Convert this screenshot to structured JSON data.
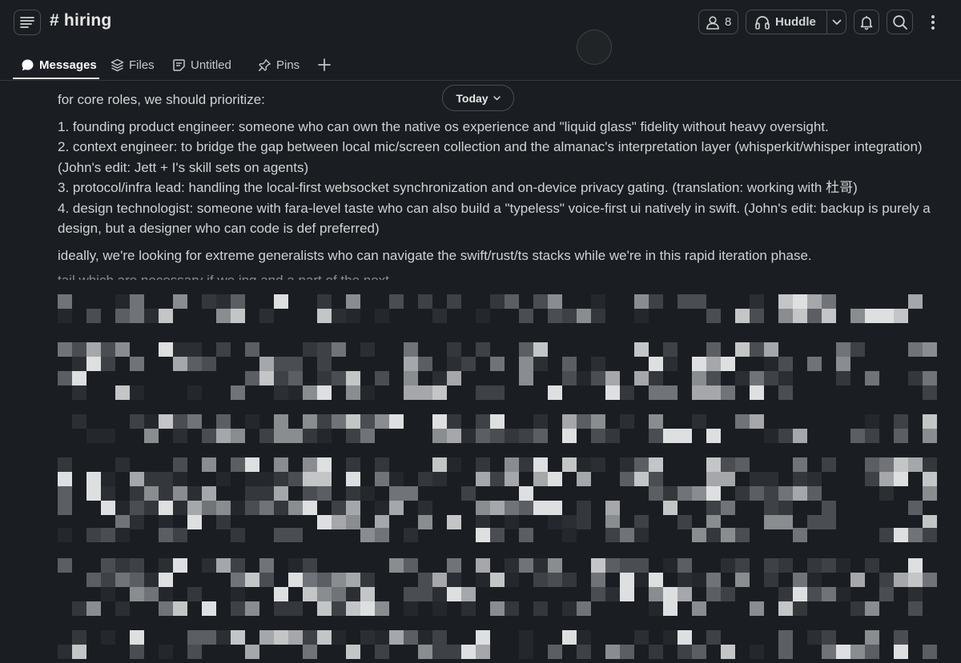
{
  "header": {
    "channel_name": "# hiring",
    "member_count": "8",
    "huddle_label": "Huddle"
  },
  "tabs": [
    {
      "label": "Messages",
      "icon": "message-bubble-icon",
      "active": true
    },
    {
      "label": "Files",
      "icon": "layers-icon",
      "active": false
    },
    {
      "label": "Untitled",
      "icon": "canvas-note-icon",
      "active": false
    },
    {
      "label": "Pins",
      "icon": "pin-icon",
      "active": false
    }
  ],
  "date_divider": {
    "label": "Today"
  },
  "message": {
    "intro": "for core roles, we should prioritize:",
    "items": [
      "1. founding product engineer: someone who can own the native os experience and \"liquid glass\" fidelity without heavy oversight.",
      "2. context engineer: to bridge the gap between local mic/screen collection and the almanac's interpretation layer (whisperkit/whisper integration) (John's edit: Jett + I's skill sets on agents)",
      "3. protocol/infra lead: handling the local-first websocket synchronization and on-device privacy gating. (translation: working with 杜哥)",
      "4. design technologist: someone with fara-level taste who can also build a \"typeless\" voice-first ui natively in swift. (John's edit: backup is purely a design, but a designer who can code is def preferred)"
    ],
    "outro": "ideally, we're looking for extreme generalists who can navigate the swift/rust/ts stacks while we're in this rapid iteration phase.",
    "cut_line": "                                   tail  which are necessary if we                                    ing  and  a part of the  next"
  },
  "colors": {
    "background": "#1a1d21",
    "text": "#d1d2d3",
    "border": "#4a4d52"
  }
}
